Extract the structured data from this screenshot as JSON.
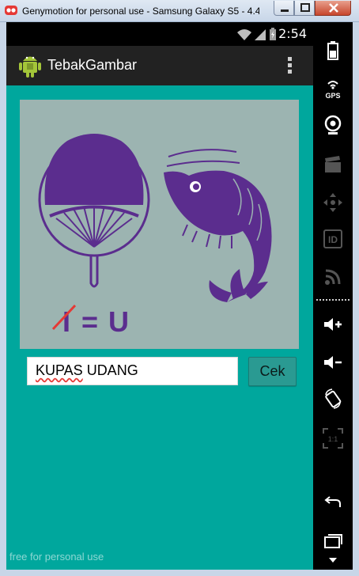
{
  "window": {
    "title": "Genymotion for personal use - Samsung Galaxy S5 - 4.4.4...",
    "watermark": "free for personal use"
  },
  "statusbar": {
    "time": "2:54"
  },
  "app": {
    "title": "TebakGambar"
  },
  "puzzle": {
    "equation_left": "I",
    "equation_sign": "=",
    "equation_right": "U",
    "colors": {
      "background": "#9cb4b1",
      "figure": "#5b2d8e",
      "strike": "#e53935"
    }
  },
  "answer": {
    "value_word1": "KUPAS",
    "value_rest": " UDANG",
    "submit_label": "Cek"
  },
  "sidepanel": {
    "gps_label": "GPS",
    "id_label": "ID",
    "scale_label": "1:1"
  },
  "colors": {
    "content_bg": "#00a79d",
    "actionbar_bg": "#222222"
  }
}
